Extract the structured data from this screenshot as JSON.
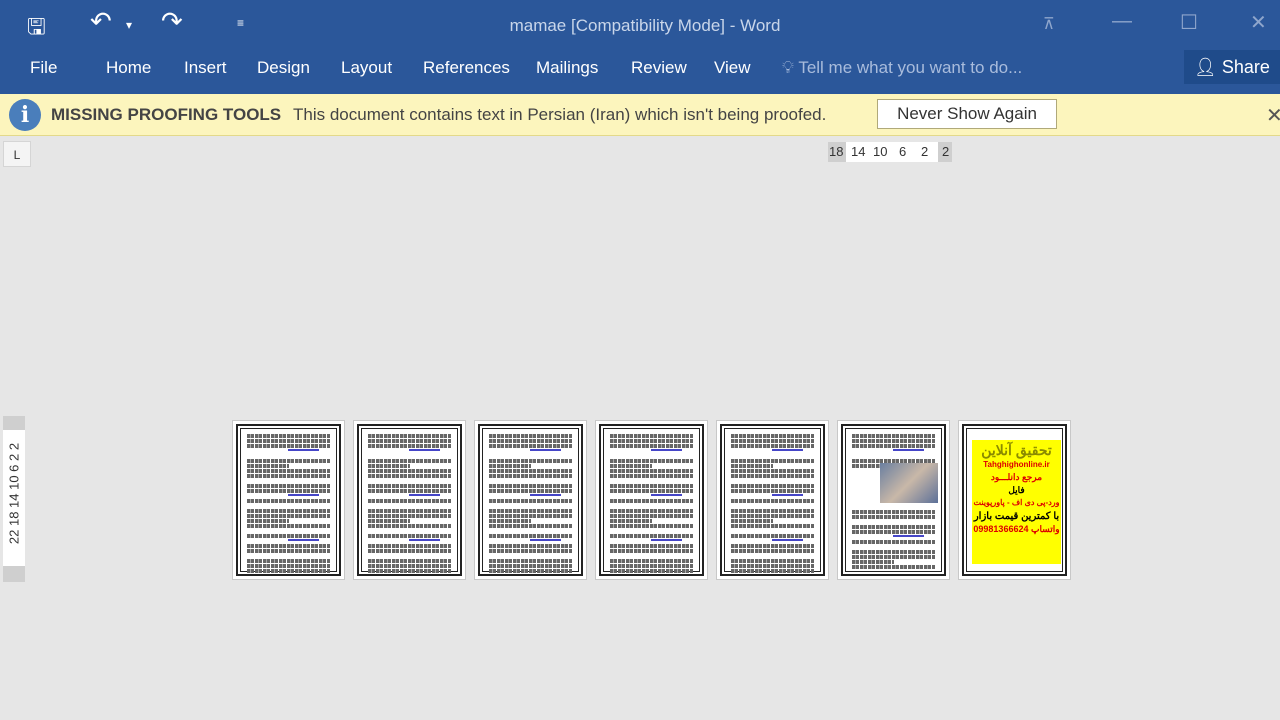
{
  "titlebar": {
    "title": "mamae [Compatibility Mode] - Word",
    "qat": [
      {
        "icon": "save-icon",
        "glyph": "🖫"
      },
      {
        "icon": "undo-icon",
        "glyph": "↶"
      },
      {
        "icon": "dropdown-icon",
        "glyph": "▾"
      },
      {
        "icon": "redo-icon",
        "glyph": "↷"
      },
      {
        "icon": "customize-qat-icon",
        "glyph": "≡"
      }
    ],
    "window": {
      "ribbon_display": "⊼",
      "minimize": "—",
      "maximize": "☐",
      "close": "✕"
    }
  },
  "ribbon": {
    "tabs": [
      "File",
      "Home",
      "Insert",
      "Design",
      "Layout",
      "References",
      "Mailings",
      "Review",
      "View"
    ],
    "tell_me": "Tell me what you want to do...",
    "share": "Share"
  },
  "message_bar": {
    "title": "MISSING PROOFING TOOLS",
    "text": "This document contains text in Persian (Iran) which isn't being proofed.",
    "button": "Never Show Again",
    "close": "✕",
    "icon": "info-icon"
  },
  "ruler": {
    "tab_stop": "L",
    "horizontal": [
      "18",
      "14",
      "10",
      "6",
      "2",
      "2"
    ],
    "vertical": "22 18 14 10 6 2 2"
  },
  "ad": {
    "line1": "تحقیق آنلاین",
    "line2": "Tahghighonline.ir",
    "line3": "مرجع دانلـــود",
    "line4": "فایل",
    "line5": "ورد-پی دی اف - پاورپوینت",
    "line6": "با کمترین قیمت بازار",
    "line7": "09981366624 واتساپ"
  },
  "colors": {
    "accent": "#2b579a",
    "message_bar": "#fcf5bd",
    "ad_bg": "#ffff00",
    "ad_text": "#ff0000"
  }
}
